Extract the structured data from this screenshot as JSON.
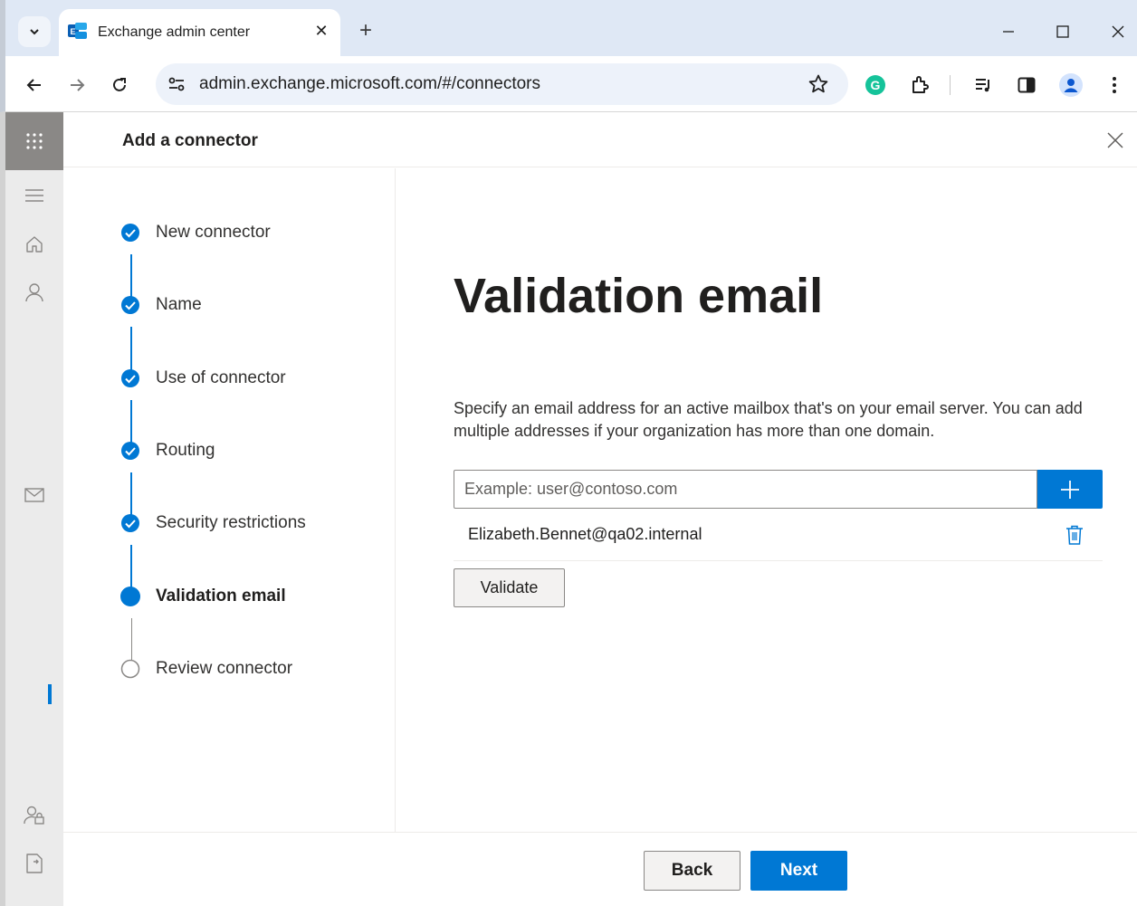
{
  "browser": {
    "tab_title": "Exchange admin center",
    "url": "admin.exchange.microsoft.com/#/connectors"
  },
  "panel": {
    "title": "Add a connector"
  },
  "steps": [
    {
      "label": "New connector",
      "state": "complete"
    },
    {
      "label": "Name",
      "state": "complete"
    },
    {
      "label": "Use of connector",
      "state": "complete"
    },
    {
      "label": "Routing",
      "state": "complete"
    },
    {
      "label": "Security restrictions",
      "state": "complete"
    },
    {
      "label": "Validation email",
      "state": "current"
    },
    {
      "label": "Review connector",
      "state": "pending"
    }
  ],
  "content": {
    "heading": "Validation email",
    "description": "Specify an email address for an active mailbox that's on your email server. You can add multiple addresses if your organization has more than one domain.",
    "email_placeholder": "Example: user@contoso.com",
    "email_value": "",
    "emails": [
      "Elizabeth.Bennet@qa02.internal"
    ],
    "validate_label": "Validate"
  },
  "footer": {
    "back_label": "Back",
    "next_label": "Next"
  },
  "colors": {
    "accent": "#0078d4",
    "rail": "#ebebeb",
    "waffle_tile": "#8a8886"
  }
}
